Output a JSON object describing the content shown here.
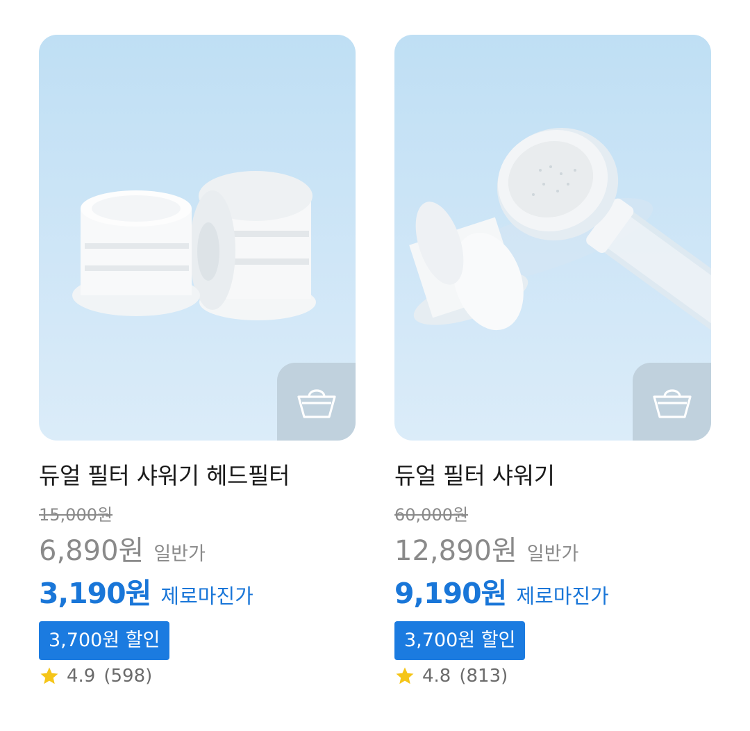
{
  "products": [
    {
      "title": "듀얼 필터 샤워기 헤드필터",
      "original_price": "15,000원",
      "normal_price": "6,890원",
      "normal_label": "일반가",
      "zero_price": "3,190원",
      "zero_label": "제로마진가",
      "discount_badge": "3,700원 할인",
      "rating": "4.9",
      "review_count": "(598)",
      "image_icon": "filter-cartridges-image",
      "cart_icon": "shopping-basket-icon"
    },
    {
      "title": "듀얼 필터 샤워기",
      "original_price": "60,000원",
      "normal_price": "12,890원",
      "normal_label": "일반가",
      "zero_price": "9,190원",
      "zero_label": "제로마진가",
      "discount_badge": "3,700원 할인",
      "rating": "4.8",
      "review_count": "(813)",
      "image_icon": "shower-head-with-filter-image",
      "cart_icon": "shopping-basket-icon"
    }
  ],
  "colors": {
    "accent": "#1976d8",
    "badge_bg": "#1b7be0",
    "muted": "#8a8a8a",
    "star": "#f5c518",
    "image_bg": "#c5e2f6"
  }
}
